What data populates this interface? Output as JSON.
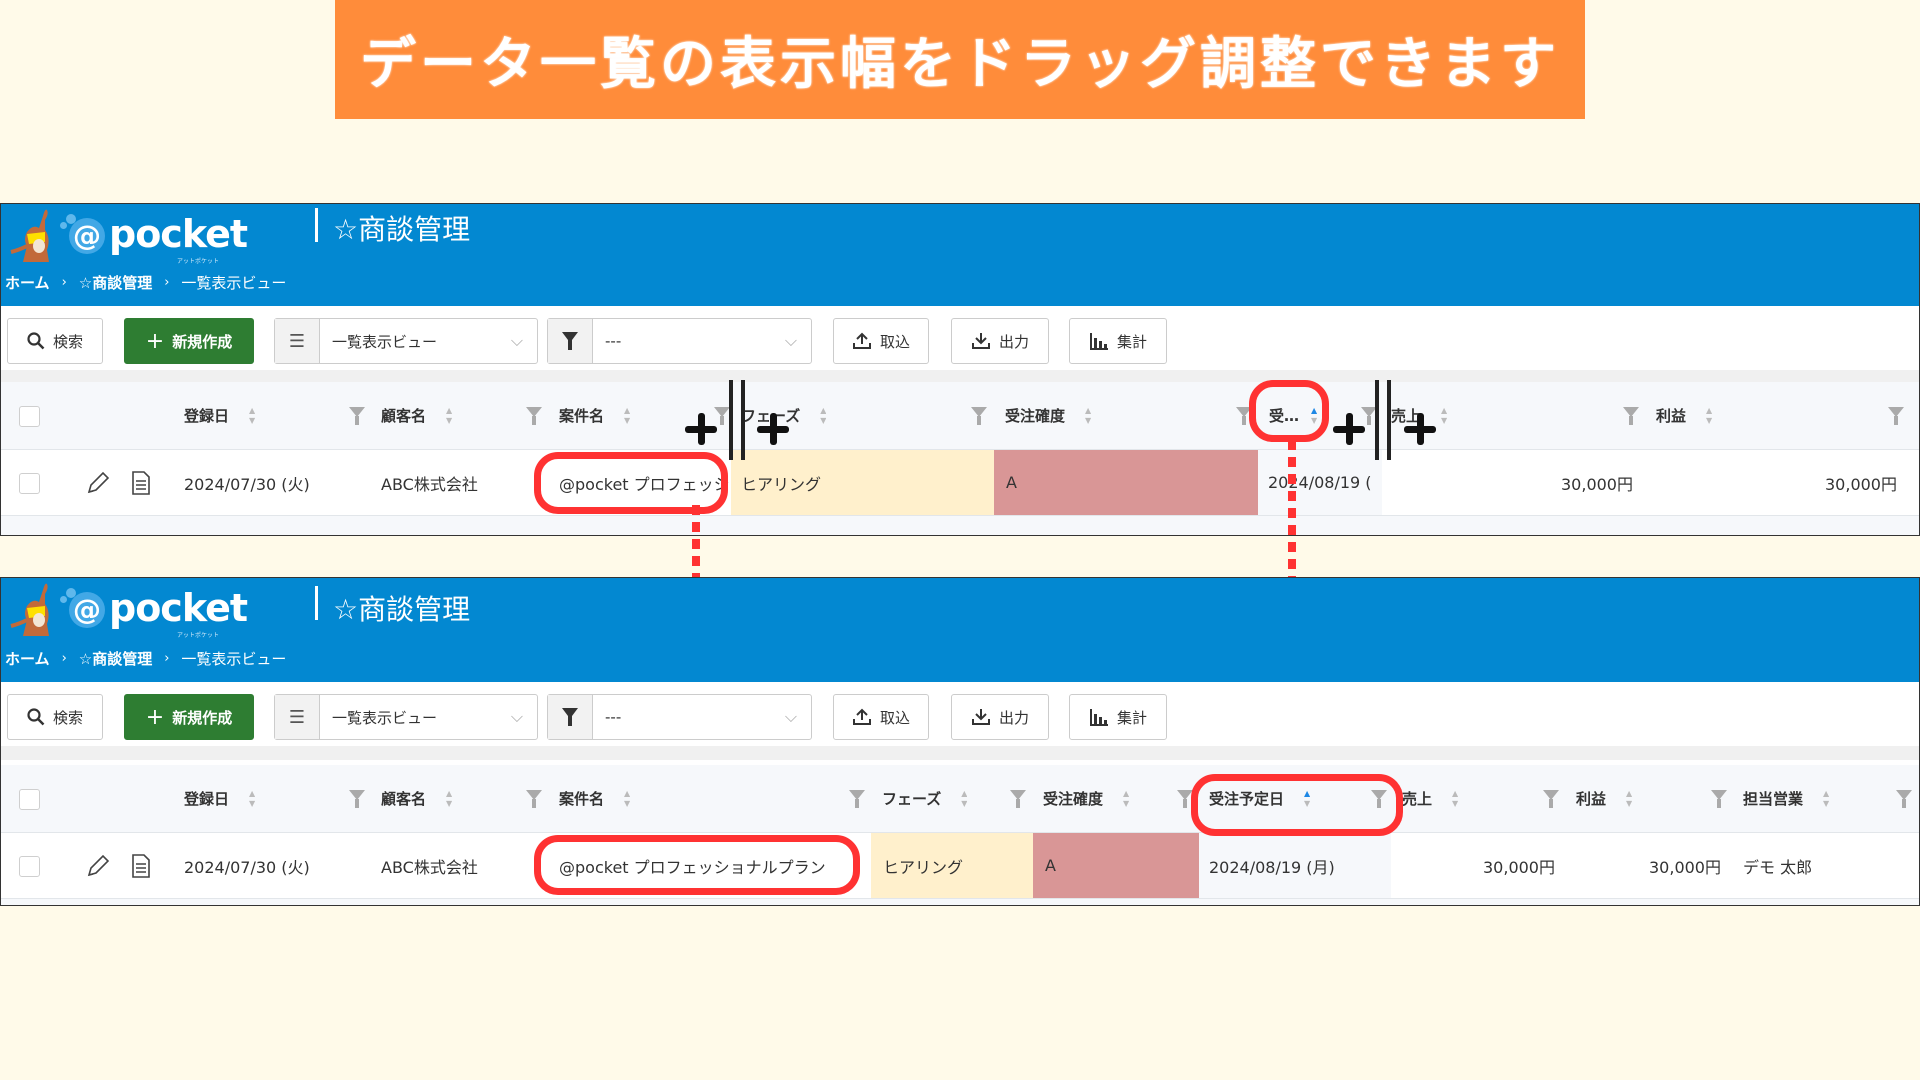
{
  "banner": {
    "text": "データ一覧の表示幅をドラッグ調整できます",
    "color": "#ff8c3a"
  },
  "app": {
    "logo_text": "pocket",
    "logo_at": "@",
    "logo_sub": "アットポケット",
    "page_title": "☆商談管理",
    "breadcrumb": [
      "ホーム",
      "☆商談管理",
      "一覧表示ビュー"
    ],
    "breadcrumb_sep": "›",
    "brand_color": "#0388d1"
  },
  "toolbar": {
    "search_label": "検索",
    "new_label": "新規作成",
    "view_select_value": "一覧表示ビュー",
    "filter_select_value": "---",
    "import_label": "取込",
    "export_label": "出力",
    "aggregate_label": "集計"
  },
  "before": {
    "columns": [
      "登録日",
      "顧客名",
      "案件名",
      "フェーズ",
      "受注確度",
      "受…",
      "売上",
      "利益"
    ],
    "row": {
      "registered": "2024/07/30 (火)",
      "customer": "ABC株式会社",
      "deal_name": "@pocket プロフェッショ",
      "phase": "ヒアリング",
      "probability": "A",
      "expected_date": "2024/08/19 (",
      "sales": "30,000円",
      "profit": "30,000円"
    }
  },
  "after": {
    "columns": [
      "登録日",
      "顧客名",
      "案件名",
      "フェーズ",
      "受注確度",
      "受注予定日",
      "売上",
      "利益",
      "担当営業"
    ],
    "row": {
      "registered": "2024/07/30 (火)",
      "customer": "ABC株式会社",
      "deal_name": "@pocket プロフェッショナルプラン",
      "phase": "ヒアリング",
      "probability": "A",
      "expected_date": "2024/08/19 (月)",
      "sales": "30,000円",
      "profit": "30,000円",
      "owner": "デモ 太郎"
    }
  },
  "colors": {
    "phase_bg": "#fff0cc",
    "probability_bg": "#d99696",
    "highlight": "#ff3232",
    "new_button": "#2e7d32"
  }
}
